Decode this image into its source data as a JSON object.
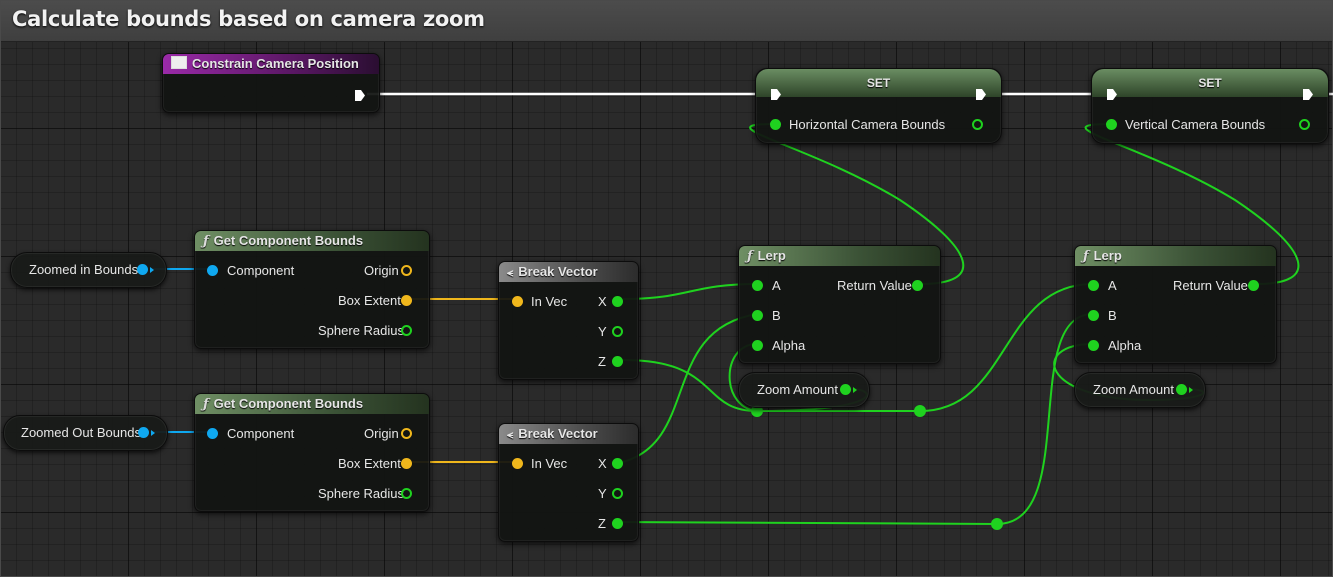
{
  "comment": {
    "title": "Calculate bounds based on camera zoom"
  },
  "colors": {
    "float_pin": "#1fd21f",
    "object_pin": "#0fa8f0",
    "vector_pin": "#f0b71c",
    "exec_pin": "#ffffff",
    "function_header": "#3b5236",
    "event_header": "#5a1764"
  },
  "nodes": {
    "constrain": {
      "title": "Constrain Camera Position",
      "icon": "event-icon"
    },
    "set_horizontal": {
      "title": "SET",
      "pin": "Horizontal Camera Bounds"
    },
    "set_vertical": {
      "title": "SET",
      "pin": "Vertical Camera Bounds"
    },
    "zoomed_in_var": {
      "label": "Zoomed in Bounds"
    },
    "zoomed_out_var": {
      "label": "Zoomed Out Bounds"
    },
    "gcb_1": {
      "title": "Get Component Bounds",
      "component": "Component",
      "origin": "Origin",
      "box_extent": "Box Extent",
      "sphere_radius": "Sphere Radius"
    },
    "gcb_2": {
      "title": "Get Component Bounds",
      "component": "Component",
      "origin": "Origin",
      "box_extent": "Box Extent",
      "sphere_radius": "Sphere Radius"
    },
    "break_1": {
      "title": "Break Vector",
      "in_vec": "In Vec",
      "x": "X",
      "y": "Y",
      "z": "Z"
    },
    "break_2": {
      "title": "Break Vector",
      "in_vec": "In Vec",
      "x": "X",
      "y": "Y",
      "z": "Z"
    },
    "lerp_1": {
      "title": "Lerp",
      "a": "A",
      "b": "B",
      "alpha": "Alpha",
      "return_value": "Return Value"
    },
    "lerp_2": {
      "title": "Lerp",
      "a": "A",
      "b": "B",
      "alpha": "Alpha",
      "return_value": "Return Value"
    },
    "zoom_amount_1": {
      "label": "Zoom Amount"
    },
    "zoom_amount_2": {
      "label": "Zoom Amount"
    }
  }
}
